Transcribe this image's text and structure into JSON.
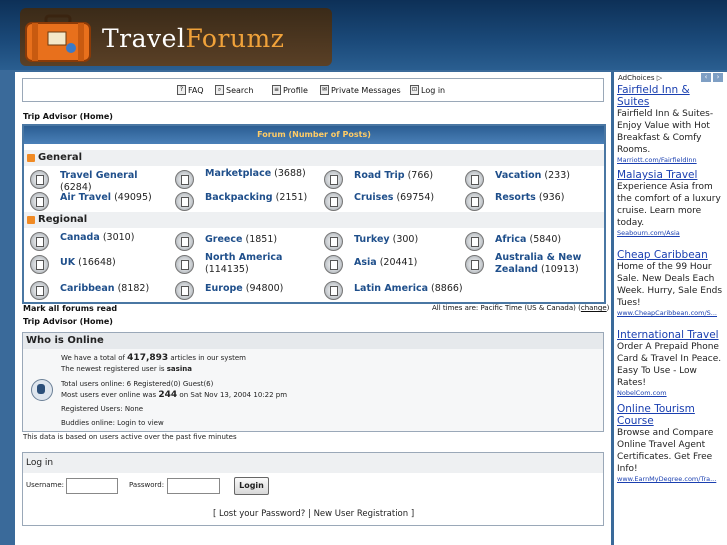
{
  "header": {
    "logo_part1": "Travel",
    "logo_part2": "Forumz"
  },
  "nav": {
    "faq": "FAQ",
    "search": "Search",
    "profile": "Profile",
    "pm": "Private Messages",
    "login": "Log in"
  },
  "breadcrumb_top": "Trip Advisor (Home)",
  "forum_header": "Forum (Number of Posts)",
  "categories": [
    {
      "name": "General",
      "forums": [
        {
          "name": "Travel General",
          "count": "(6284)"
        },
        {
          "name": "Marketplace",
          "count": "(3688)"
        },
        {
          "name": "Road Trip",
          "count": "(766)"
        },
        {
          "name": "Vacation",
          "count": "(233)"
        },
        {
          "name": "Air Travel",
          "count": "(49095)"
        },
        {
          "name": "Backpacking",
          "count": "(2151)"
        },
        {
          "name": "Cruises",
          "count": "(69754)"
        },
        {
          "name": "Resorts",
          "count": "(936)"
        }
      ]
    },
    {
      "name": "Regional",
      "forums": [
        {
          "name": "Canada",
          "count": "(3010)"
        },
        {
          "name": "Greece",
          "count": "(1851)"
        },
        {
          "name": "Turkey",
          "count": "(300)"
        },
        {
          "name": "Africa",
          "count": "(5840)"
        },
        {
          "name": "UK",
          "count": "(16648)"
        },
        {
          "name": "North America",
          "count": "(114135)"
        },
        {
          "name": "Asia",
          "count": "(20441)"
        },
        {
          "name": "Australia & New Zealand",
          "count": "(10913)"
        },
        {
          "name": "Caribbean",
          "count": "(8182)"
        },
        {
          "name": "Europe",
          "count": "(94800)"
        },
        {
          "name": "Latin America",
          "count": "(8866)"
        }
      ]
    }
  ],
  "mark_all": "Mark all forums read",
  "times": {
    "text": "All times are: Pacific Time (US & Canada) (",
    "link": "change",
    "end": ")"
  },
  "breadcrumb_bottom": "Trip Advisor (Home)",
  "who": {
    "title": "Who is Online",
    "line1_a": "We have a total of ",
    "articles": "417,893",
    "line1_b": " articles in our system",
    "line2_a": "The newest registered user is ",
    "newest": "sasina",
    "line3": "Total users online: 6 Registered(0) Guest(6)",
    "line4_a": "Most users ever online was ",
    "most": "244",
    "line4_b": " on Sat Nov 13, 2004 10:22 pm",
    "line5": "Registered Users: None",
    "line6": "Buddies online: Login to view"
  },
  "data_note": "This data is based on users active over the past five minutes",
  "login": {
    "title": "Log in",
    "username_label": "Username:",
    "password_label": "Password:",
    "button": "Login",
    "lost": "[ Lost your Password? | New User Registration ]"
  },
  "ads": {
    "adchoices": "AdChoices",
    "items": [
      {
        "title": "Fairfield Inn & Suites",
        "body": "Fairfield Inn & Suites-Enjoy Value with Hot Breakfast & Comfy Rooms.",
        "url": "Marriott.com/FairfieldInn"
      },
      {
        "title": "Malaysia Travel",
        "body": "Experience Asia from the comfort of a luxury cruise. Learn more today.",
        "url": "Seabourn.com/Asia"
      },
      {
        "title": "Cheap Caribbean",
        "body": "Home of the 99 Hour Sale. New Deals Each Week. Hurry, Sale Ends Tues!",
        "url": "www.CheapCaribbean.com/S..."
      },
      {
        "title": "International Travel",
        "body": "Order A Prepaid Phone Card & Travel In Peace. Easy To Use - Low Rates!",
        "url": "NobelCom.com"
      },
      {
        "title": "Online Tourism Course",
        "body": "Browse and Compare Online Travel Agent Certificates. Get Free Info!",
        "url": "www.EarnMyDegree.com/Tra..."
      }
    ]
  }
}
